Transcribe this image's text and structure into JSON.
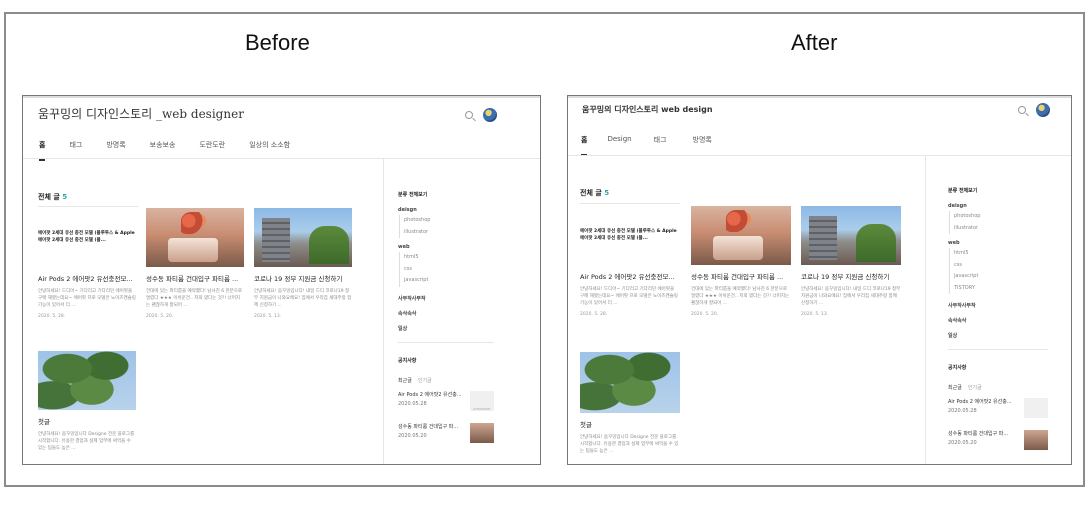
{
  "labels": {
    "before": "Before",
    "after": "After"
  },
  "before": {
    "blog_title": "움꾸밍의 디자인스토리 _web designer",
    "nav": [
      "홈",
      "태그",
      "방명록",
      "보송보송",
      "도란도란",
      "일상의 소소함"
    ],
    "post_count_label": "전체 글",
    "post_count": "5",
    "posts": [
      {
        "thumb_text": "에어팟 2세대 유선 충전 모델 (블루투스 & Apple 에어팟 2세대 유선 충전 모델 (블...",
        "title": "Air Pods 2 에어팟2 유선충전모...",
        "summary": "안녕하세요! 드디어~ 기다리고 기다리던 에어팟을 구매 해봤는데요~ 에어팟 프로 모델은 노이즈캔슬링 기능이 있어서 더 ...",
        "date": "2020. 5. 28."
      },
      {
        "title": "성수동 파티룸 건대입구 파티룸 ...",
        "summary": "건대에 있는 파티룸을 예약했다! 남사친 6 한분으로 얼렸다 ★★★ 이쉬운건.. 저희 였다는 것?! 너머지는 괜찮하게 잘되어 ...",
        "date": "2020. 5. 20."
      },
      {
        "title": "코로나 19 정부 지원금 신청하기",
        "summary": "안녕하세요! 움꾸밍입니다! 내일 드디 코로나19 정부 지원금이 나와요에요! 집에서 우리집 세대주랑 함께 신청하기 ...",
        "date": "2020. 5. 13."
      },
      {
        "title": "첫글",
        "summary": "안녕하세요! 움꾸밍입니다 Designe 전문 블로그를 시작합니다. 유용한 결업과 실제 업무에 써먹을 수 있는 팁들도 높은 ...",
        "date": ""
      }
    ],
    "sidebar": {
      "head": "분류 전체보기",
      "categories": [
        {
          "name": "deisgn",
          "subs": [
            "photoshop",
            "illustrator"
          ]
        },
        {
          "name": "web",
          "subs": [
            "html5",
            "css",
            "javascript"
          ]
        }
      ],
      "tops": [
        "사부작사부작",
        "속삭속삭",
        "일상"
      ],
      "notice": "공지사항",
      "tab_active": "최근글",
      "tab_inactive": "인기글",
      "recent": [
        {
          "title": "Air Pods 2 에어팟2 유선충...",
          "date": "2020.05.28",
          "thumb": "previewer"
        },
        {
          "title": "성수동 파티룸 건대입구 파...",
          "date": "2020.05.20"
        }
      ]
    }
  },
  "after": {
    "blog_title": "움꾸밍의 디자인스토리 web design",
    "nav": [
      "홈",
      "Design",
      "태그",
      "방명록"
    ],
    "post_count_label": "전체 글",
    "post_count": "5",
    "posts": [
      {
        "thumb_text": "에어팟 2세대 유선 충전 모델 (블루투스 & Apple 에어팟 2세대 유선 충전 모델 (블...",
        "title": "Air Pods 2 에어팟2 유선충전모...",
        "summary": "안녕하세요! 드디어~ 기다리고 기다리던 에어팟을 구매 해봤는데요~ 에어팟 프로 모델은 노이즈캔슬링 기능이 있어서 더 ...",
        "date": "2020. 5. 28."
      },
      {
        "title": "성수동 파티룸 건대입구 파티룸 ...",
        "summary": "건대에 있는 파티룸을 예약했다! 남사친 6 한분으로 얼렸다 ★★★ 이쉬운건.. 저희 였다는 것?! 너머지는 괜찮하게 잘되어 ...",
        "date": "2020. 5. 20."
      },
      {
        "title": "코로나 19 정부 지원금 신청하기",
        "summary": "안녕하세요! 움꾸밍입니다! 내일 드디 코로나19 정부 지원금이 나와요에요! 집에서 우리집 세대주랑 함께 신청하기 ...",
        "date": "2020. 5. 13."
      },
      {
        "title": "첫글",
        "summary": "안녕하세요! 움꾸밍입니다 Designe 전문 블로그를 시작합니다. 유용한 결업과 실제 업무에 써먹을 수 있는 팁들도 높은 ...",
        "date": ""
      }
    ],
    "sidebar": {
      "head": "분류 전체보기",
      "categories": [
        {
          "name": "deisgn",
          "subs": [
            "photoshop",
            "illustrator"
          ]
        },
        {
          "name": "web",
          "subs": [
            "html5",
            "css",
            "javascript",
            "TISTORY"
          ]
        }
      ],
      "tops": [
        "사부작사부작",
        "속삭속삭",
        "일상"
      ],
      "notice": "공지사항",
      "tab_active": "최근글",
      "tab_inactive": "인기글",
      "recent": [
        {
          "title": "Air Pods 2 에어팟2 유선충...",
          "date": "2020.05.28"
        },
        {
          "title": "성수동 파티룸 건대입구 파...",
          "date": "2020.05.20"
        }
      ]
    }
  }
}
